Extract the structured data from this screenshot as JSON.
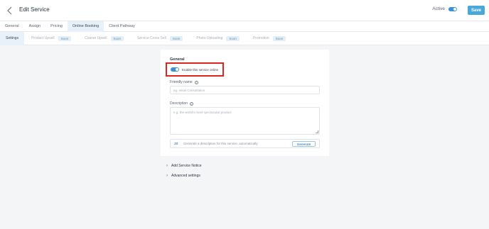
{
  "header": {
    "title": "Edit Service",
    "active_label": "Active",
    "save_label": "Save"
  },
  "tabs": [
    {
      "label": "General"
    },
    {
      "label": "Assign"
    },
    {
      "label": "Pricing"
    },
    {
      "label": "Online Booking"
    },
    {
      "label": "Client Pathway"
    }
  ],
  "subtabs": [
    {
      "label": "Settings",
      "badge": ""
    },
    {
      "label": "Product Upsell",
      "badge": "Soon"
    },
    {
      "label": "Course Upsell",
      "badge": "Soon"
    },
    {
      "label": "Service Cross Sell",
      "badge": "Soon"
    },
    {
      "label": "Photo Uploading",
      "badge": "Soon"
    },
    {
      "label": "Promotion",
      "badge": "Soon"
    }
  ],
  "general": {
    "title": "General",
    "enable_label": "Enable this service online",
    "friendly_name_label": "Friendly name",
    "friendly_name_placeholder": "eg. Initial Consultation",
    "description_label": "Description",
    "description_placeholder": "e.g. the world's most spectacular product",
    "ai_icon_text": "JS",
    "generate_text": "Generate a description for this service, automatically.",
    "generate_button": "Generate"
  },
  "sections": {
    "service_notice": "Add Service Notice",
    "advanced": "Advanced settings"
  },
  "colors": {
    "accent": "#3d8fd8",
    "save_button": "#4aa8d8",
    "highlight_border": "#e0231d"
  }
}
